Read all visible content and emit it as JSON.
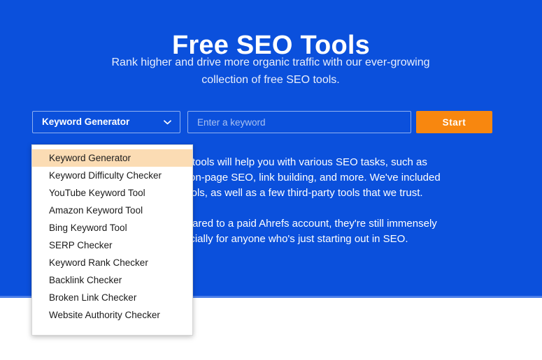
{
  "hero": {
    "title": "Free SEO Tools",
    "subtitle": "Rank higher and drive more organic traffic with our ever-growing collection of free SEO tools.",
    "background_color": "#0b50dc",
    "text_color": "#ffffff"
  },
  "search": {
    "select": {
      "selected_label": "Keyword Generator",
      "chevron_icon": "chevron-down-icon",
      "border_color": "#8fb0ef"
    },
    "input": {
      "value": "",
      "placeholder": "Enter a keyword",
      "placeholder_color": "#a9c1f0"
    },
    "start_button": {
      "label": "Start",
      "background_color": "#f8870f",
      "text_color": "#ffffff"
    }
  },
  "dropdown": {
    "open": true,
    "highlight_color": "#fbdcb4",
    "selected_index": 0,
    "items": [
      {
        "label": "Keyword Generator"
      },
      {
        "label": "Keyword Difficulty Checker"
      },
      {
        "label": "YouTube Keyword Tool"
      },
      {
        "label": "Amazon Keyword Tool"
      },
      {
        "label": "Bing Keyword Tool"
      },
      {
        "label": "SERP Checker"
      },
      {
        "label": "Keyword Rank Checker"
      },
      {
        "label": "Backlink Checker"
      },
      {
        "label": "Broken Link Checker"
      },
      {
        "label": "Website Authority Checker"
      }
    ]
  },
  "body": {
    "paragraph_1": "These free SEO tools will help you with various SEO tasks, such as keyword research, on-page SEO, link building, and more. We've included our free SEO tools, as well as a few third-party tools that we trust.",
    "paragraph_2": "While limited compared to a paid Ahrefs account, they're still immensely useful, especially for anyone who's just starting out in SEO."
  }
}
